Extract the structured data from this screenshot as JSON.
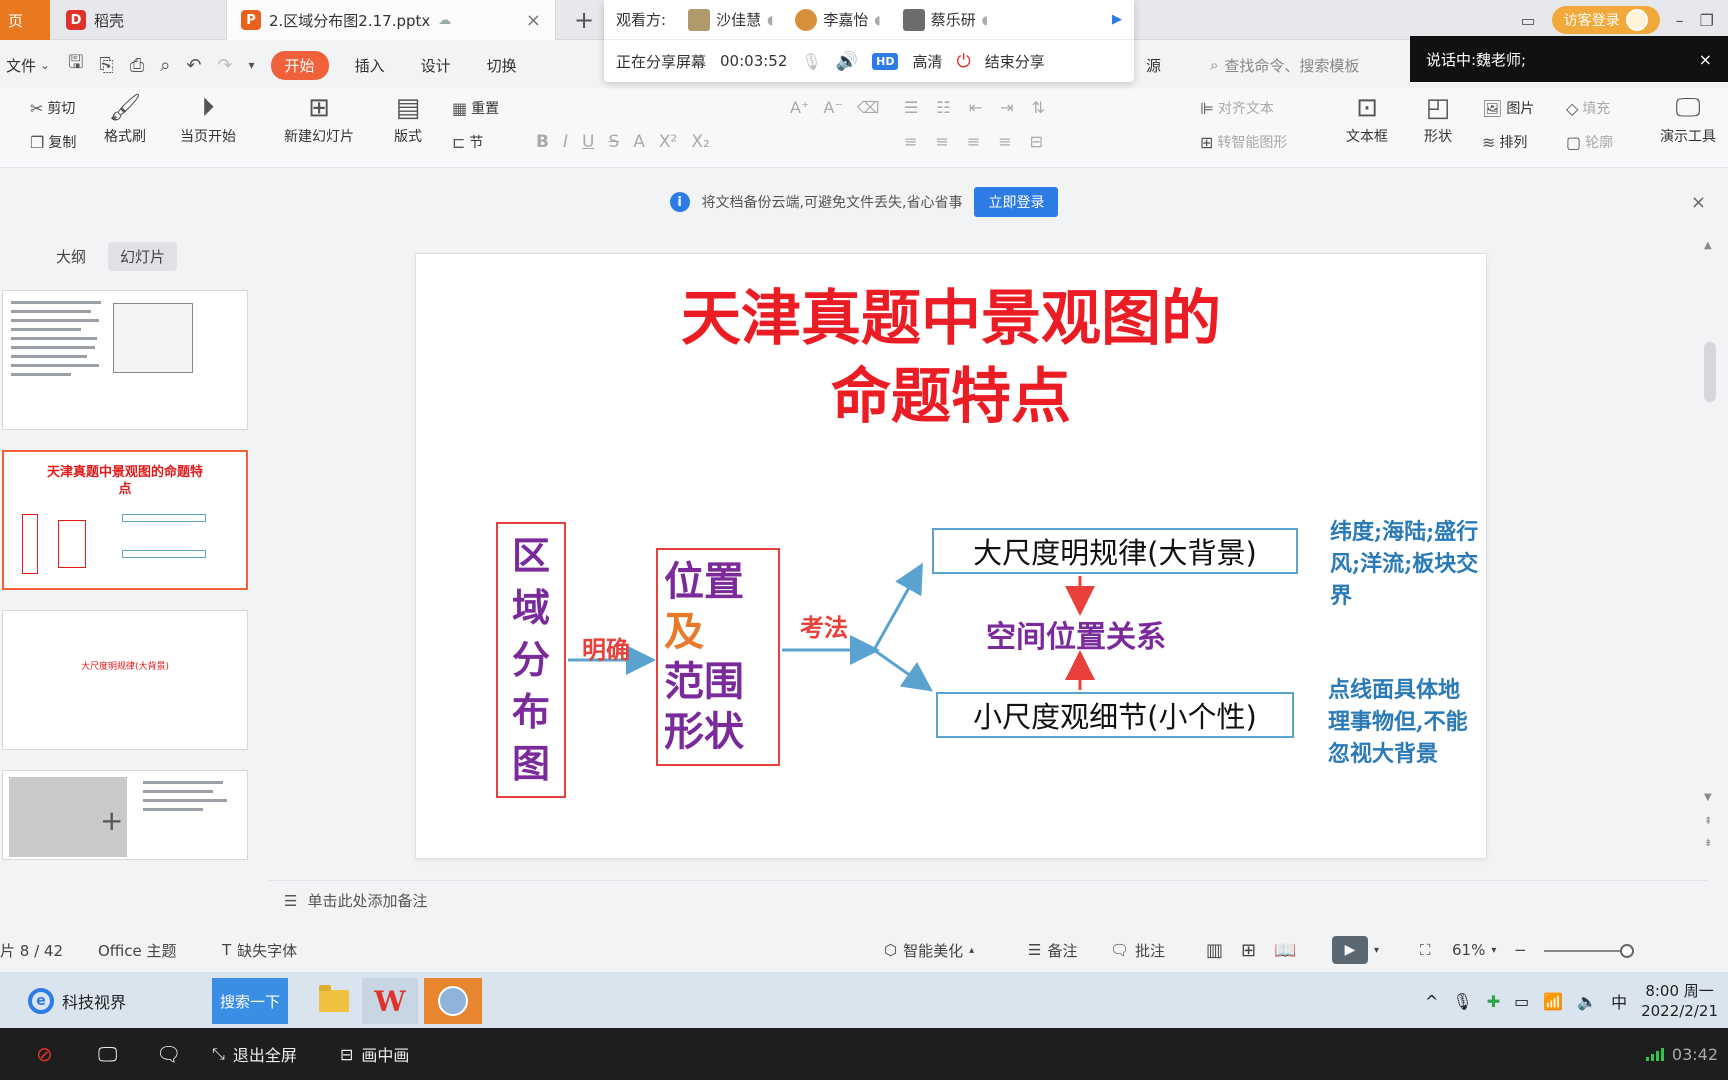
{
  "tabbar": {
    "home_label": "页",
    "wps_tab_label": "稻壳",
    "doc_tab_label": "2.区域分布图2.17.pptx",
    "guest_login": "访客登录"
  },
  "share": {
    "viewers_label": "观看方:",
    "viewers": [
      "沙佳慧",
      "李嘉怡",
      "蔡乐研"
    ],
    "sharing_label": "正在分享屏幕",
    "duration": "00:03:52",
    "hd_badge": "HD",
    "quality_label": "高清",
    "end_label": "结束分享",
    "speaking_text": "说话中:魏老师;"
  },
  "menu": {
    "file_label": "文件",
    "tabs": [
      "开始",
      "插入",
      "设计",
      "切换"
    ],
    "hidden_tab_tail": "源",
    "search_placeholder": "查找命令、搜索模板"
  },
  "ribbon": {
    "cut": "剪切",
    "copy": "复制",
    "format_painter": "格式刷",
    "from_current": "当页开始",
    "new_slide": "新建幻灯片",
    "layout": "版式",
    "reset": "重置",
    "section": "节",
    "align_text": "对齐文本",
    "smart_shape": "转智能图形",
    "textbox": "文本框",
    "shape": "形状",
    "picture": "图片",
    "arrange": "排列",
    "fill": "填充",
    "outline": "轮廓",
    "presentation_tools": "演示工具"
  },
  "banner": {
    "message": "将文档备份云端,可避免文件丢失,省心省事",
    "login_button": "立即登录"
  },
  "panel": {
    "tab_outline": "大纲",
    "tab_slides": "幻灯片",
    "thumb_selected_title": "天津真题中景观图的命题特点",
    "thumb3_text": "大尺度明规律(大背景)"
  },
  "slide": {
    "title_line1": "天津真题中景观图的",
    "title_line2": "命题特点",
    "box_region_chars": [
      "区",
      "域",
      "分",
      "布",
      "图"
    ],
    "box_position_lines": [
      "位置",
      "及",
      "范围",
      "形状"
    ],
    "label_mingque": "明确",
    "label_kaofa": "考法",
    "box_large": "大尺度明规律(大背景)",
    "label_spatial": "空间位置关系",
    "box_small": "小尺度观细节(小个性)",
    "note_top": "纬度;海陆;盛行风;洋流;板块交界",
    "note_bottom": "点线面具体地理事物但,不能忽视大背景",
    "colors": {
      "title_red": "#ec1c24",
      "purple": "#7a2a9a",
      "arrow_red": "#e8403a",
      "box_blue": "#5aa3d0",
      "note_blue": "#2a7ab8"
    }
  },
  "notes": {
    "placeholder": "单击此处添加备注"
  },
  "status": {
    "slide_index": "片 8 / 42",
    "theme": "Office 主题",
    "missing_font": "缺失字体",
    "beautify": "智能美化",
    "notes": "备注",
    "comment": "批注",
    "zoom": "61%"
  },
  "taskbar": {
    "ie_label": "科技视界",
    "search_button": "搜索一下",
    "ime": "中",
    "time": "8:00 周一",
    "date": "2022/2/21"
  },
  "meeting": {
    "exit_fullscreen": "退出全屏",
    "pip": "画中画",
    "elapsed": "03:42"
  }
}
